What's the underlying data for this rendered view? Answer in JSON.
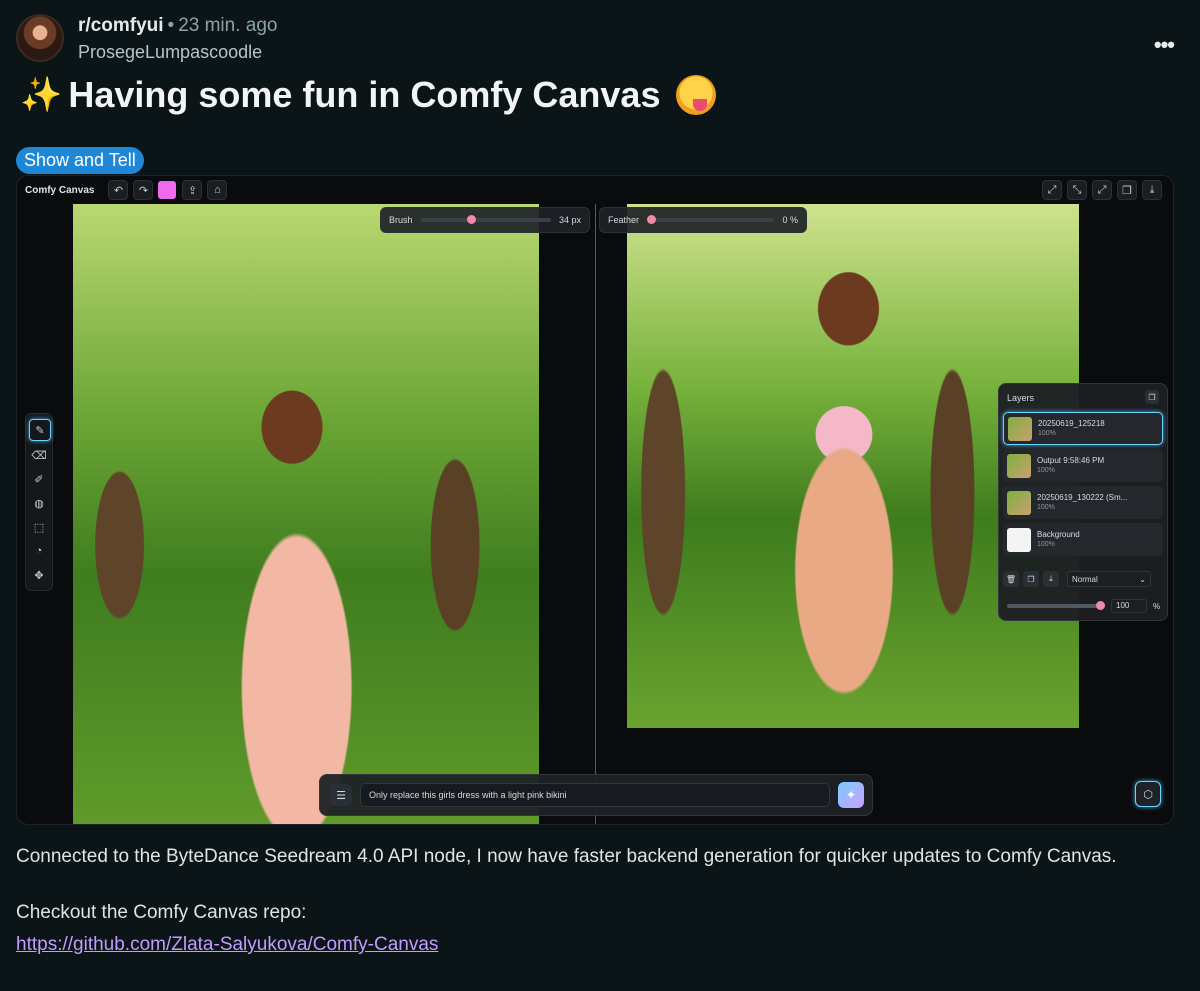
{
  "post": {
    "subreddit": "r/comfyui",
    "time": "23 min. ago",
    "author": "ProsegeLumpascoodle",
    "title": "Having some fun in Comfy Canvas",
    "title_prefix_emoji": "sparkles-icon",
    "title_suffix_emoji": "zany-face-icon",
    "flair": "Show and Tell",
    "body_p1": "Connected to the ByteDance Seedream 4.0 API node, I now have faster backend generation for quicker updates to Comfy Canvas.",
    "body_p2_label": "Checkout the Comfy Canvas repo:",
    "link": "https://github.com/Zlata-Salyukova/Comfy-Canvas",
    "flair_color": "#1e88d6",
    "link_color": "#c49bff"
  },
  "app": {
    "name": "Comfy Canvas",
    "swatch_color": "#ee6bf0",
    "brush": {
      "label": "Brush",
      "value": "34",
      "unit": "px"
    },
    "feather": {
      "label": "Feather",
      "value": "0",
      "unit": "%"
    },
    "layers": {
      "title": "Layers",
      "items": [
        {
          "name": "20250619_125218",
          "opacity": "100%",
          "selected": true
        },
        {
          "name": "Output 9:58:46 PM",
          "opacity": "100%"
        },
        {
          "name": "20250619_130222 (Sm...",
          "opacity": "100%"
        },
        {
          "name": "Background",
          "opacity": "100%"
        }
      ],
      "blend_mode": "Normal",
      "opacity_value": "100",
      "opacity_unit": "%"
    },
    "prompt": "Only replace this girls dress with a light pink bikini"
  }
}
